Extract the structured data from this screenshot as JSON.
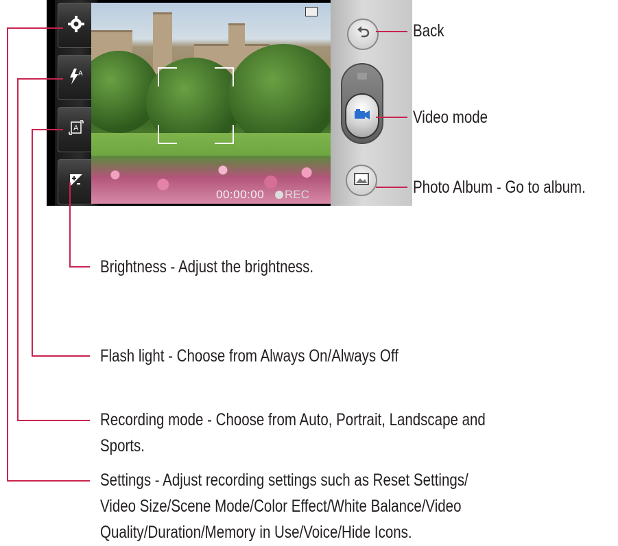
{
  "viewfinder": {
    "timecode": "00:00:00",
    "rec_label": "REC"
  },
  "left_buttons": [
    {
      "icon": "gear-icon"
    },
    {
      "icon": "flash-auto-icon",
      "text": "A"
    },
    {
      "icon": "recording-mode-icon",
      "text": "A"
    },
    {
      "icon": "brightness-icon"
    }
  ],
  "right_buttons": [
    {
      "icon": "back-icon"
    },
    {
      "icon": "camera-mode-icon"
    },
    {
      "icon": "video-mode-icon"
    },
    {
      "icon": "photo-album-icon"
    }
  ],
  "callouts": {
    "back": "Back",
    "video_mode": "Video mode",
    "photo_album": "Photo Album - Go to album.",
    "brightness": "Brightness - Adjust the brightness.",
    "flash": "Flash light - Choose from Always On/Always Off",
    "recording_mode_1": "Recording mode - Choose from Auto, Portrait, Landscape and",
    "recording_mode_2": "Sports.",
    "settings_1": "Settings - Adjust recording settings such as Reset Settings/",
    "settings_2": "Video Size/Scene Mode/Color Effect/White Balance/Video",
    "settings_3": "Quality/Duration/Memory in Use/Voice/Hide Icons."
  },
  "colors": {
    "callout_line": "#c8234e",
    "text": "#231f20"
  }
}
